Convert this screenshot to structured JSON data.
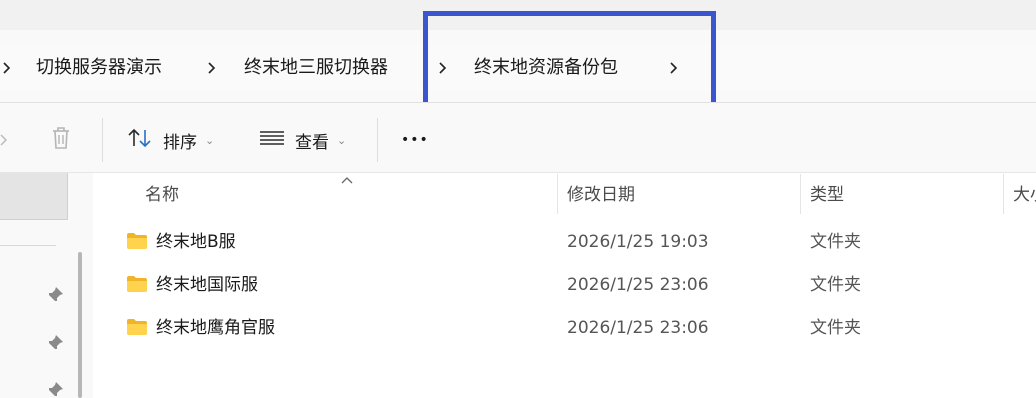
{
  "breadcrumb": {
    "items": [
      {
        "label": "切换服务器演示"
      },
      {
        "label": "终末地三服切换器"
      },
      {
        "label": "终末地资源备份包"
      }
    ]
  },
  "toolbar": {
    "sort_label": "排序",
    "view_label": "查看",
    "more_label": "•••"
  },
  "columns": {
    "name": "名称",
    "date": "修改日期",
    "type": "类型",
    "size": "大小"
  },
  "files": [
    {
      "name": "终末地B服",
      "date": "2026/1/25 19:03",
      "type": "文件夹"
    },
    {
      "name": "终末地国际服",
      "date": "2026/1/25 23:06",
      "type": "文件夹"
    },
    {
      "name": "终末地鹰角官服",
      "date": "2026/1/25 23:06",
      "type": "文件夹"
    }
  ],
  "colors": {
    "highlight": "#3b55d1",
    "folder": "#f4c542"
  }
}
